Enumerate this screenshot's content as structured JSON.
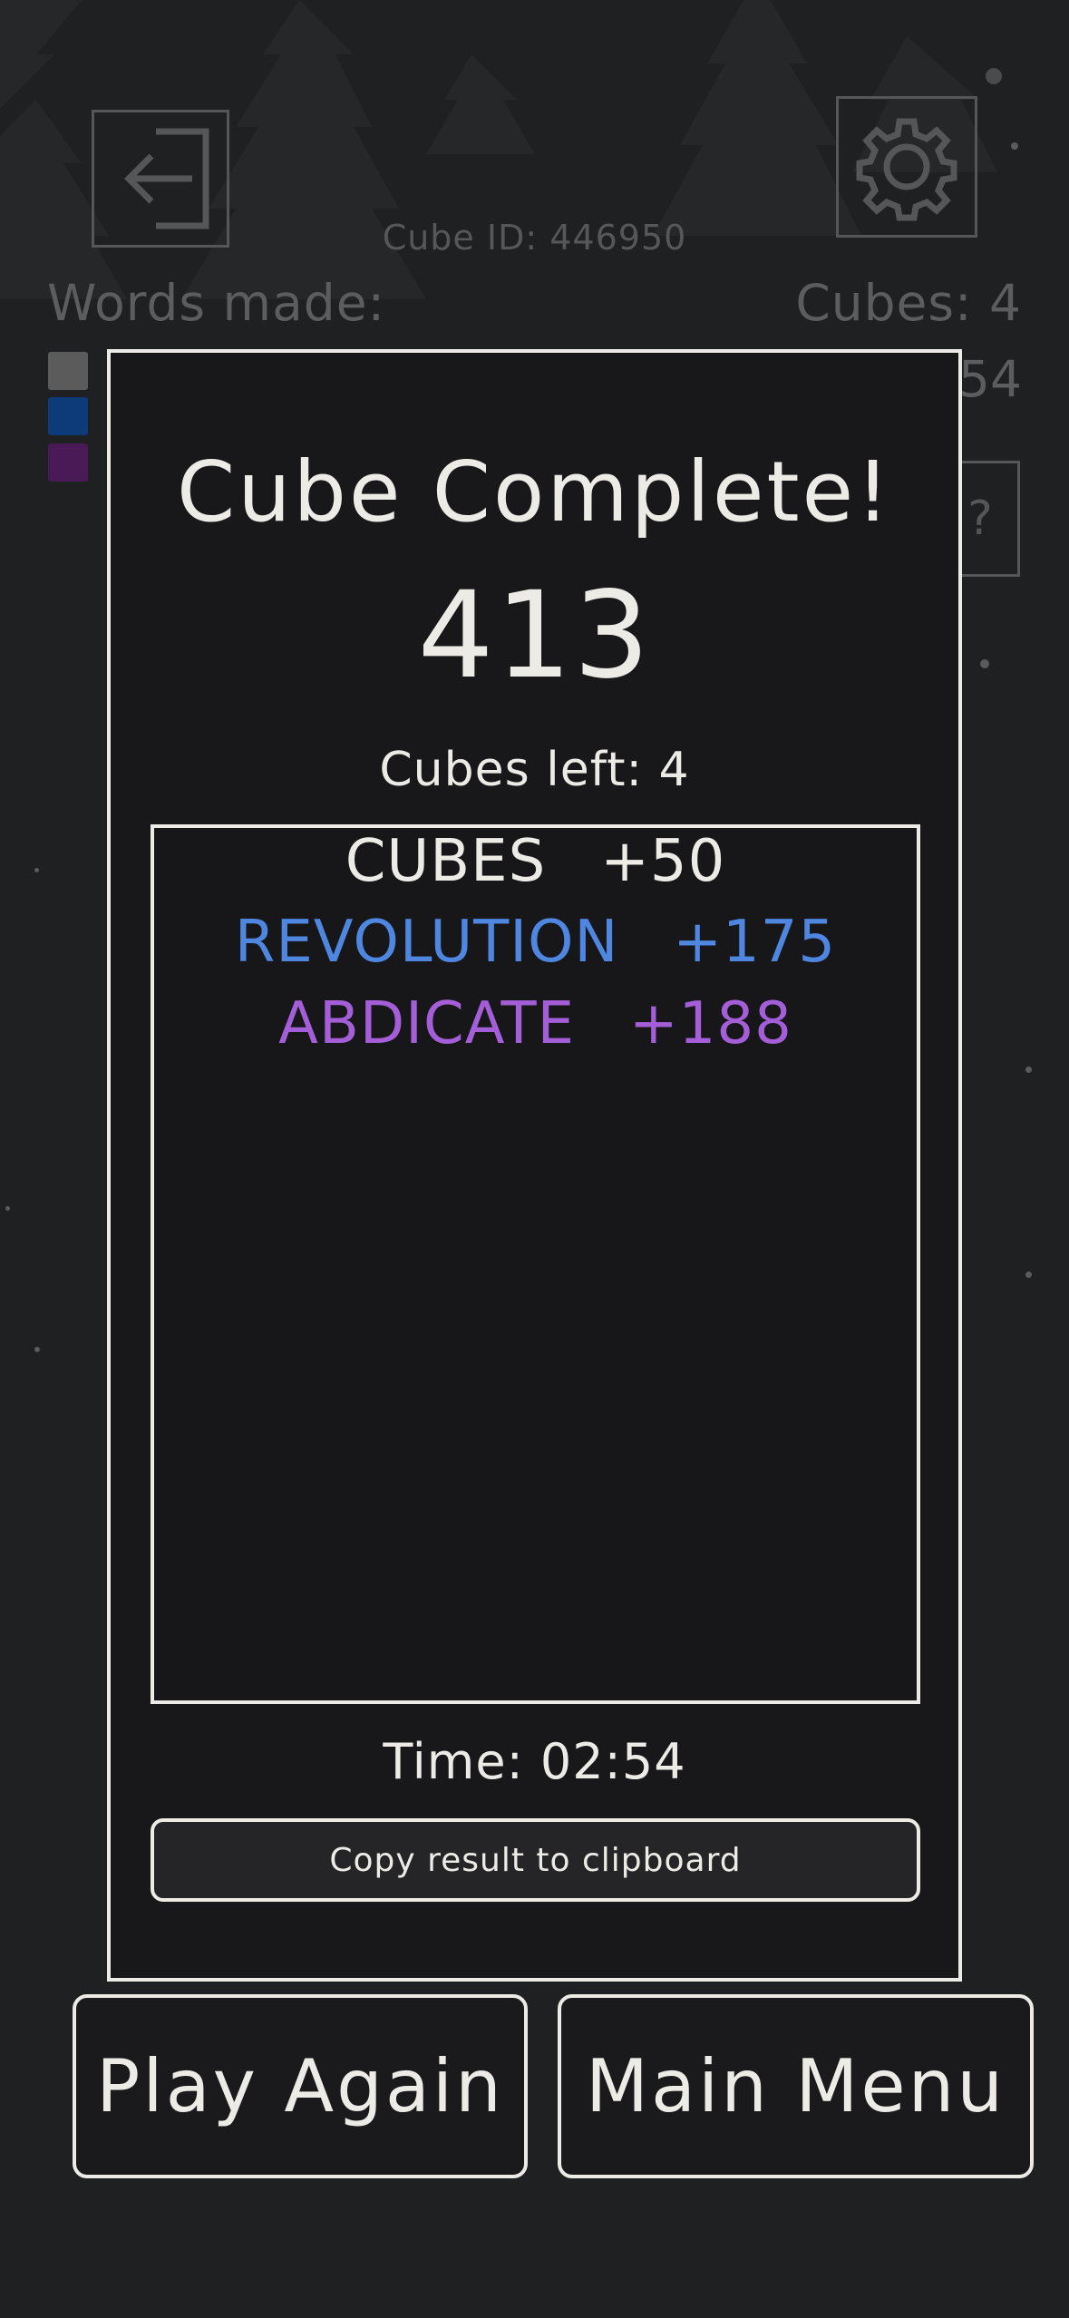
{
  "background": {
    "cube_id_label": "Cube ID: 446950",
    "words_made_label": "Words made:",
    "cubes_label": "Cubes: 4",
    "time_partial": "54",
    "hint_glyph": "?",
    "swatch_colors": [
      "#5b5b5b",
      "#0d3a78",
      "#4a1a57"
    ]
  },
  "dialog": {
    "title": "Cube Complete!",
    "score": "413",
    "cubes_left": "Cubes left: 4",
    "words": [
      {
        "word": "CUBES",
        "points": "+50",
        "color": "#ecebe6"
      },
      {
        "word": "REVOLUTION",
        "points": "+175",
        "color": "#4f86e0"
      },
      {
        "word": "ABDICATE",
        "points": "+188",
        "color": "#a45ed8"
      }
    ],
    "time": "Time: 02:54",
    "copy_button": "Copy result to clipboard"
  },
  "buttons": {
    "play_again": "Play Again",
    "main_menu": "Main Menu"
  },
  "icons": {
    "back": "back-arrow-icon",
    "settings": "gear-icon"
  }
}
